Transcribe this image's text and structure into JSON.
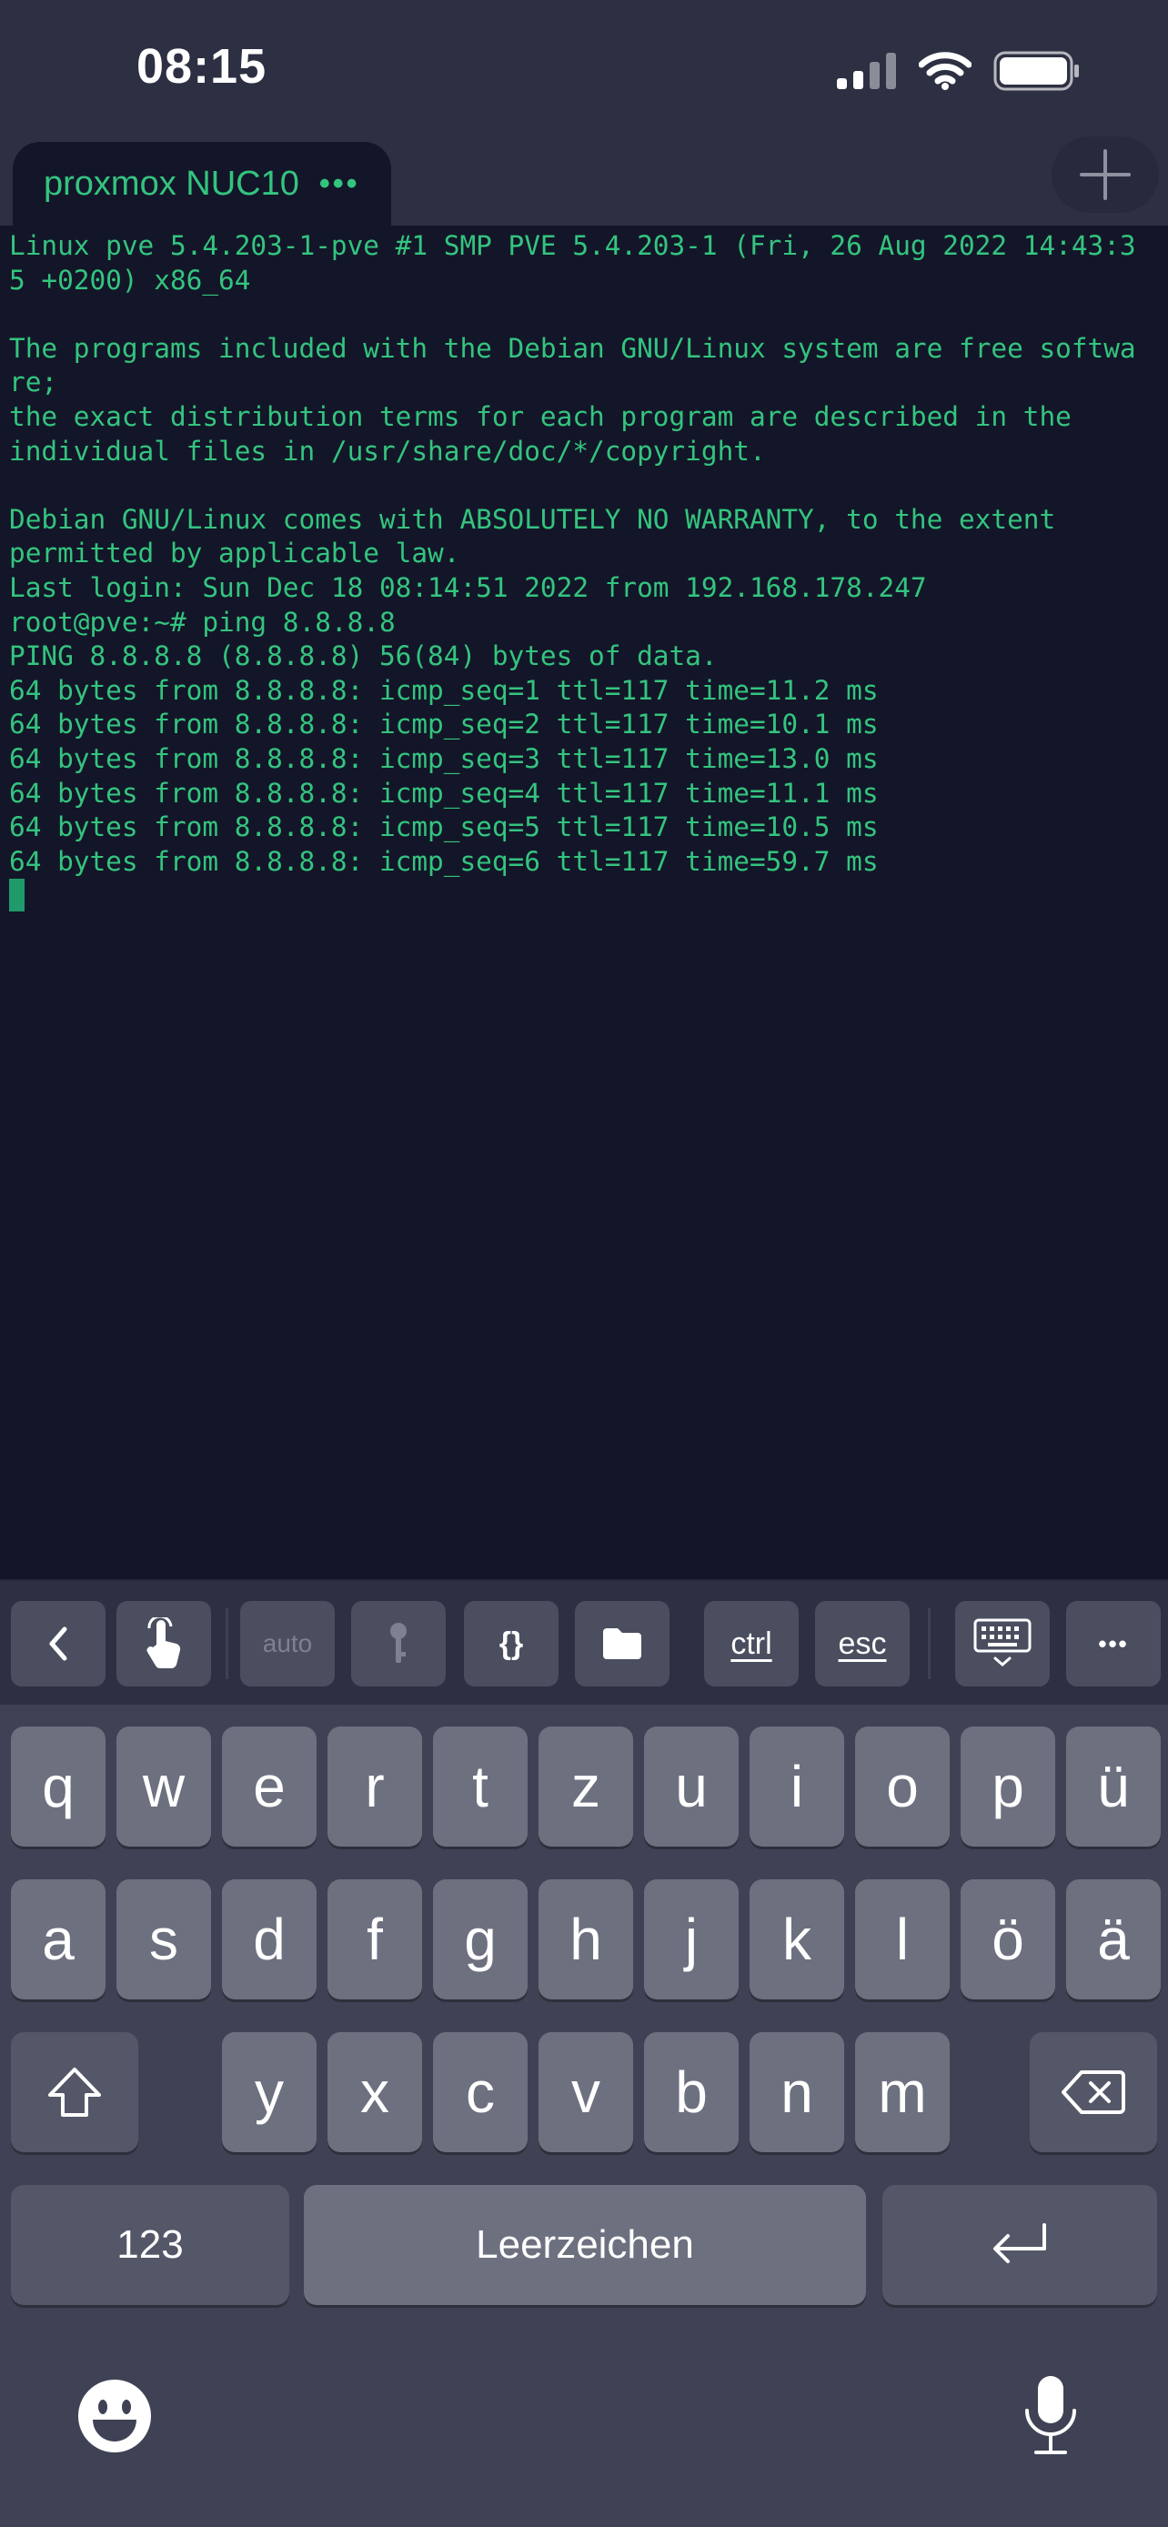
{
  "status_bar": {
    "time": "08:15"
  },
  "tab": {
    "label": "proxmox NUC10",
    "menu_glyph": "•••"
  },
  "terminal_lines": [
    "Linux pve 5.4.203-1-pve #1 SMP PVE 5.4.203-1 (Fri, 26 Aug 2022 14:43:3",
    "5 +0200) x86_64",
    "",
    "The programs included with the Debian GNU/Linux system are free softwa",
    "re;",
    "the exact distribution terms for each program are described in the",
    "individual files in /usr/share/doc/*/copyright.",
    "",
    "Debian GNU/Linux comes with ABSOLUTELY NO WARRANTY, to the extent",
    "permitted by applicable law.",
    "Last login: Sun Dec 18 08:14:51 2022 from 192.168.178.247",
    "root@pve:~# ping 8.8.8.8",
    "PING 8.8.8.8 (8.8.8.8) 56(84) bytes of data.",
    "64 bytes from 8.8.8.8: icmp_seq=1 ttl=117 time=11.2 ms",
    "64 bytes from 8.8.8.8: icmp_seq=2 ttl=117 time=10.1 ms",
    "64 bytes from 8.8.8.8: icmp_seq=3 ttl=117 time=13.0 ms",
    "64 bytes from 8.8.8.8: icmp_seq=4 ttl=117 time=11.1 ms",
    "64 bytes from 8.8.8.8: icmp_seq=5 ttl=117 time=10.5 ms",
    "64 bytes from 8.8.8.8: icmp_seq=6 ttl=117 time=59.7 ms"
  ],
  "toolbar": {
    "auto_label": "auto",
    "braces_label": "{}",
    "ctrl_label": "ctrl",
    "esc_label": "esc",
    "more_label": "•••",
    "icons": [
      "chevron-left-icon",
      "touch-hand-icon",
      "key-icon",
      "folder-icon",
      "keyboard-hide-icon"
    ]
  },
  "keyboard": {
    "row1": [
      "q",
      "w",
      "e",
      "r",
      "t",
      "z",
      "u",
      "i",
      "o",
      "p",
      "ü"
    ],
    "row2": [
      "a",
      "s",
      "d",
      "f",
      "g",
      "h",
      "j",
      "k",
      "l",
      "ö",
      "ä"
    ],
    "row3": [
      "y",
      "x",
      "c",
      "v",
      "b",
      "n",
      "m"
    ],
    "numbers_label": "123",
    "space_label": "Leerzeichen"
  },
  "colors": {
    "terminal_bg": "#131628",
    "terminal_text": "#34c47f",
    "chrome_bg": "#2d3042",
    "key_bg": "#6d707f",
    "function_key_bg": "#545767"
  }
}
